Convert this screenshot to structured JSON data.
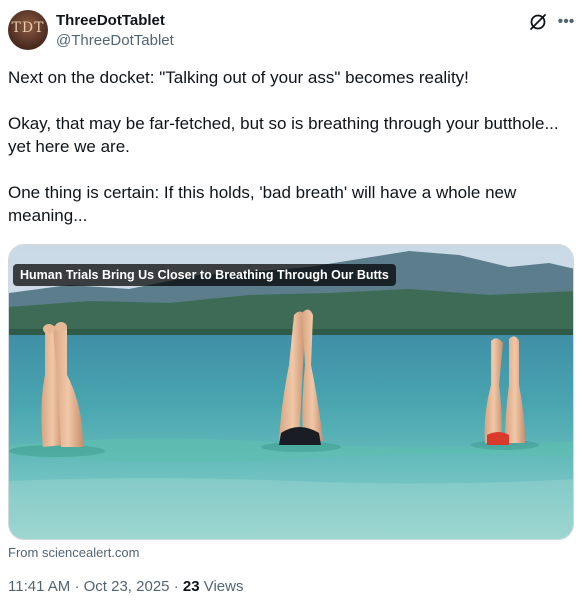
{
  "author": {
    "display_name": "ThreeDotTablet",
    "handle": "@ThreeDotTablet",
    "avatar_text": "TDT"
  },
  "icons": {
    "grok": "grok-icon",
    "more": "more-icon"
  },
  "tweet": {
    "paragraphs": [
      "Next on the docket: \"Talking out of your ass\" becomes reality!",
      "Okay, that may be far-fetched, but so is breathing through your butthole... yet here we are.",
      "One thing is certain: If this holds, 'bad breath' will have a whole new meaning..."
    ]
  },
  "card": {
    "title": "Human Trials Bring Us Closer to Breathing Through Our Butts",
    "source": "From sciencealert.com"
  },
  "meta": {
    "time": "11:41 AM",
    "separator": "·",
    "date": "Oct 23, 2025",
    "views_count": "23",
    "views_label": "Views"
  },
  "colors": {
    "text_primary": "#0f1419",
    "text_secondary": "#536471",
    "border": "#cfd9de"
  }
}
